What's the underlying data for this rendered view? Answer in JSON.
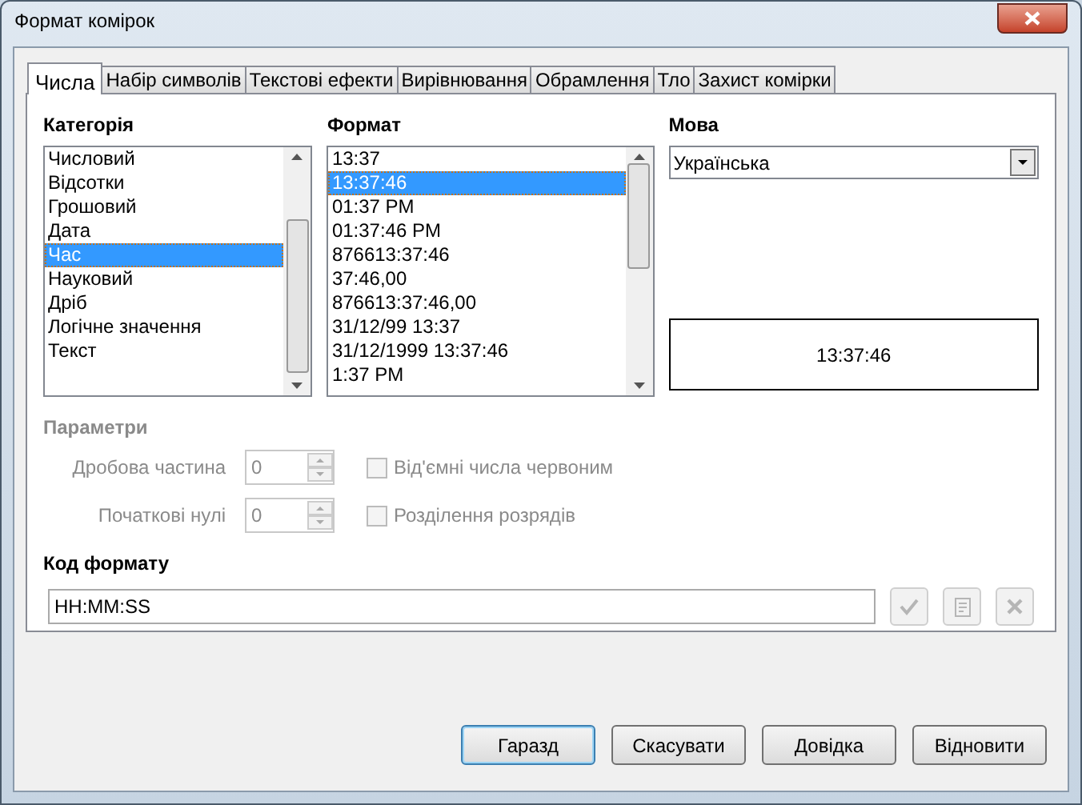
{
  "window": {
    "title": "Формат комірок"
  },
  "tabs": [
    {
      "label": "Числа",
      "selected": true
    },
    {
      "label": "Набір символів",
      "selected": false
    },
    {
      "label": "Текстові ефекти",
      "selected": false
    },
    {
      "label": "Вирівнювання",
      "selected": false
    },
    {
      "label": "Обрамлення",
      "selected": false
    },
    {
      "label": "Тло",
      "selected": false
    },
    {
      "label": "Захист комірки",
      "selected": false
    }
  ],
  "category": {
    "label": "Категорія",
    "items": [
      {
        "label": "Числовий",
        "selected": false
      },
      {
        "label": "Відсотки",
        "selected": false
      },
      {
        "label": "Грошовий",
        "selected": false
      },
      {
        "label": "Дата",
        "selected": false
      },
      {
        "label": "Час",
        "selected": true
      },
      {
        "label": "Науковий",
        "selected": false
      },
      {
        "label": "Дріб",
        "selected": false
      },
      {
        "label": "Логічне значення",
        "selected": false
      },
      {
        "label": "Текст",
        "selected": false
      }
    ]
  },
  "format": {
    "label": "Формат",
    "items": [
      {
        "label": "13:37",
        "selected": false
      },
      {
        "label": "13:37:46",
        "selected": true
      },
      {
        "label": "01:37 PM",
        "selected": false
      },
      {
        "label": "01:37:46 PM",
        "selected": false
      },
      {
        "label": "876613:37:46",
        "selected": false
      },
      {
        "label": "37:46,00",
        "selected": false
      },
      {
        "label": "876613:37:46,00",
        "selected": false
      },
      {
        "label": "31/12/99 13:37",
        "selected": false
      },
      {
        "label": "31/12/1999 13:37:46",
        "selected": false
      },
      {
        "label": "1:37 PM",
        "selected": false
      }
    ]
  },
  "language": {
    "label": "Мова",
    "value": "Українська"
  },
  "preview": "13:37:46",
  "options": {
    "label": "Параметри",
    "disabled": true,
    "fields": [
      {
        "label": "Дробова частина",
        "value": "0"
      },
      {
        "label": "Початкові нулі",
        "value": "0"
      }
    ],
    "checkboxes": [
      {
        "label": "Від'ємні числа червоним",
        "checked": false
      },
      {
        "label": "Розділення розрядів",
        "checked": false
      }
    ]
  },
  "format_code": {
    "label": "Код формату",
    "value": "HH:MM:SS",
    "actions_disabled": true
  },
  "buttons": [
    {
      "label": "Гаразд",
      "default": true
    },
    {
      "label": "Скасувати",
      "default": false
    },
    {
      "label": "Довідка",
      "default": false
    },
    {
      "label": "Відновити",
      "default": false
    }
  ]
}
